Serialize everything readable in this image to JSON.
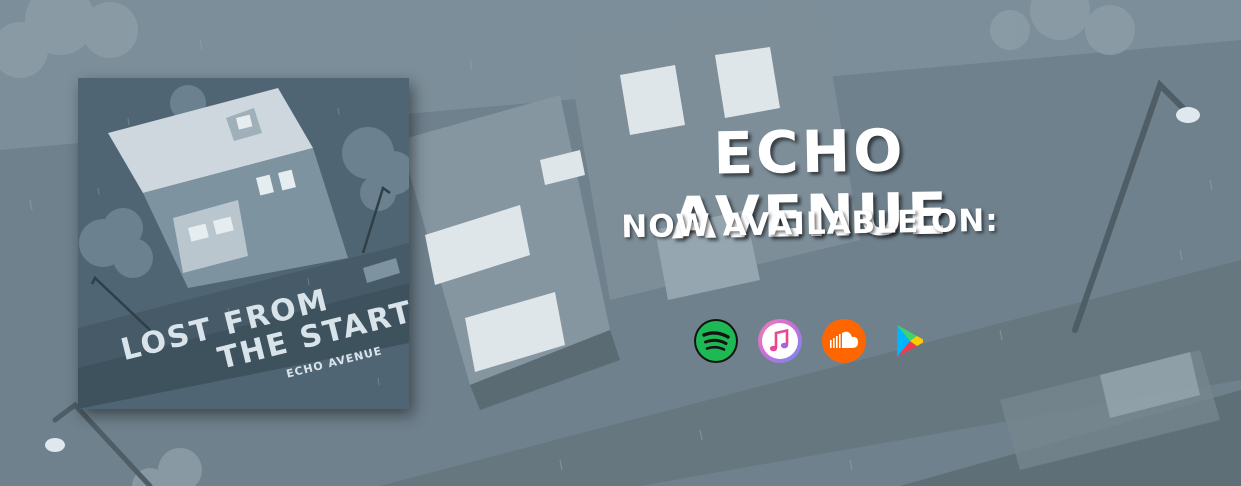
{
  "band": {
    "name": "ECHO AVENUE"
  },
  "tagline": "NOW AVAILABLE ON:",
  "album": {
    "title_line1": "LOST FROM",
    "title_line2": "THE START",
    "artist": "ECHO AVENUE"
  },
  "platforms": [
    {
      "name": "Spotify",
      "icon": "spotify-icon",
      "color": "#1db954"
    },
    {
      "name": "iTunes",
      "icon": "itunes-icon",
      "color": "#e7488f"
    },
    {
      "name": "SoundCloud",
      "icon": "soundcloud-icon",
      "color": "#ff6600"
    },
    {
      "name": "Google Play",
      "icon": "google-play-icon",
      "color": "#34a853"
    }
  ],
  "colors": {
    "background": "#6f818d",
    "text": "#ffffff"
  }
}
